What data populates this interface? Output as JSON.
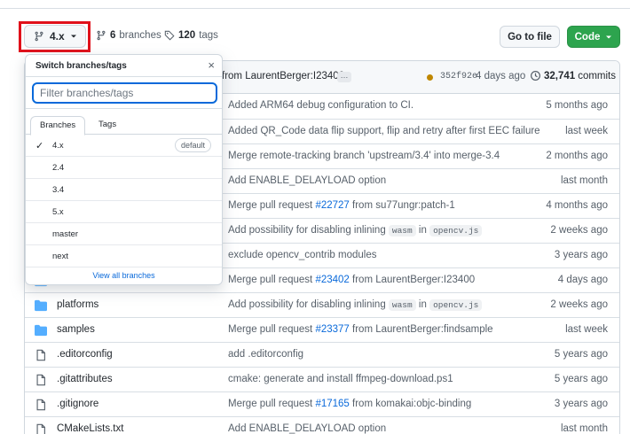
{
  "header": {
    "branch_label": "4.x",
    "branches_count": "6",
    "branches_label": "branches",
    "tags_count": "120",
    "tags_label": "tags",
    "goto_label": "Go to file",
    "code_label": "Code",
    "accent_green": "#2da44e",
    "link_blue": "#0969da"
  },
  "commit": {
    "message": "from LaurentBerger:I23400",
    "ellipsis": "…",
    "hash": "352f92e",
    "age": "4 days ago",
    "count": "32,741",
    "count_label": "commits"
  },
  "dropdown": {
    "title": "Switch branches/tags",
    "close": "×",
    "placeholder": "Filter branches/tags",
    "tab_branches": "Branches",
    "tab_tags": "Tags",
    "items": [
      {
        "name": "4.x",
        "selected": true,
        "badge": "default"
      },
      {
        "name": "2.4"
      },
      {
        "name": "3.4"
      },
      {
        "name": "5.x"
      },
      {
        "name": "master"
      },
      {
        "name": "next"
      }
    ],
    "view_all": "View all branches"
  },
  "files": [
    {
      "name": "",
      "icon": "folder-icon",
      "msg_pre": "Added ARM64 debug configuration to CI.",
      "age": "5 months ago"
    },
    {
      "name": "",
      "icon": "folder-icon",
      "msg_pre": "Added QR_Code data flip support, flip and retry after first EEC failure",
      "age": "last week"
    },
    {
      "name": "",
      "icon": "folder-icon",
      "msg_pre": "Merge remote-tracking branch 'upstream/3.4' into merge-3.4",
      "age": "2 months ago"
    },
    {
      "name": "",
      "icon": "folder-icon",
      "msg_pre": "Add ENABLE_DELAYLOAD option",
      "age": "last month"
    },
    {
      "name": "",
      "icon": "folder-icon",
      "msg_pre": "Merge pull request ",
      "link": "#22727",
      "msg_post": " from su77ungr:patch-1",
      "age": "4 months ago"
    },
    {
      "name": "",
      "icon": "folder-icon",
      "msg_pre": "Add possibility for disabling inlining ",
      "code1": "wasm",
      "mid": " in ",
      "code2": "opencv.js",
      "age": "2 weeks ago"
    },
    {
      "name": "",
      "icon": "folder-icon",
      "msg_pre": "exclude opencv_contrib modules",
      "age": "3 years ago"
    },
    {
      "name": "",
      "icon": "folder-icon",
      "msg_pre": "Merge pull request ",
      "link": "#23402",
      "msg_post": " from LaurentBerger:I23400",
      "age": "4 days ago"
    },
    {
      "name": "platforms",
      "icon": "folder-icon",
      "msg_pre": "Add possibility for disabling inlining ",
      "code1": "wasm",
      "mid": " in ",
      "code2": "opencv.js",
      "age": "2 weeks ago"
    },
    {
      "name": "samples",
      "icon": "folder-icon",
      "msg_pre": "Merge pull request ",
      "link": "#23377",
      "msg_post": " from LaurentBerger:findsample",
      "age": "last week"
    },
    {
      "name": ".editorconfig",
      "icon": "file-icon",
      "msg_pre": "add .editorconfig",
      "age": "5 years ago"
    },
    {
      "name": ".gitattributes",
      "icon": "file-icon",
      "msg_pre": "cmake: generate and install ffmpeg-download.ps1",
      "age": "5 years ago"
    },
    {
      "name": ".gitignore",
      "icon": "file-icon",
      "msg_pre": "Merge pull request ",
      "link": "#17165",
      "msg_post": " from komakai:objc-binding",
      "age": "3 years ago"
    },
    {
      "name": "CMakeLists.txt",
      "icon": "file-icon",
      "msg_pre": "Add ENABLE_DELAYLOAD option",
      "age": "last month"
    }
  ]
}
